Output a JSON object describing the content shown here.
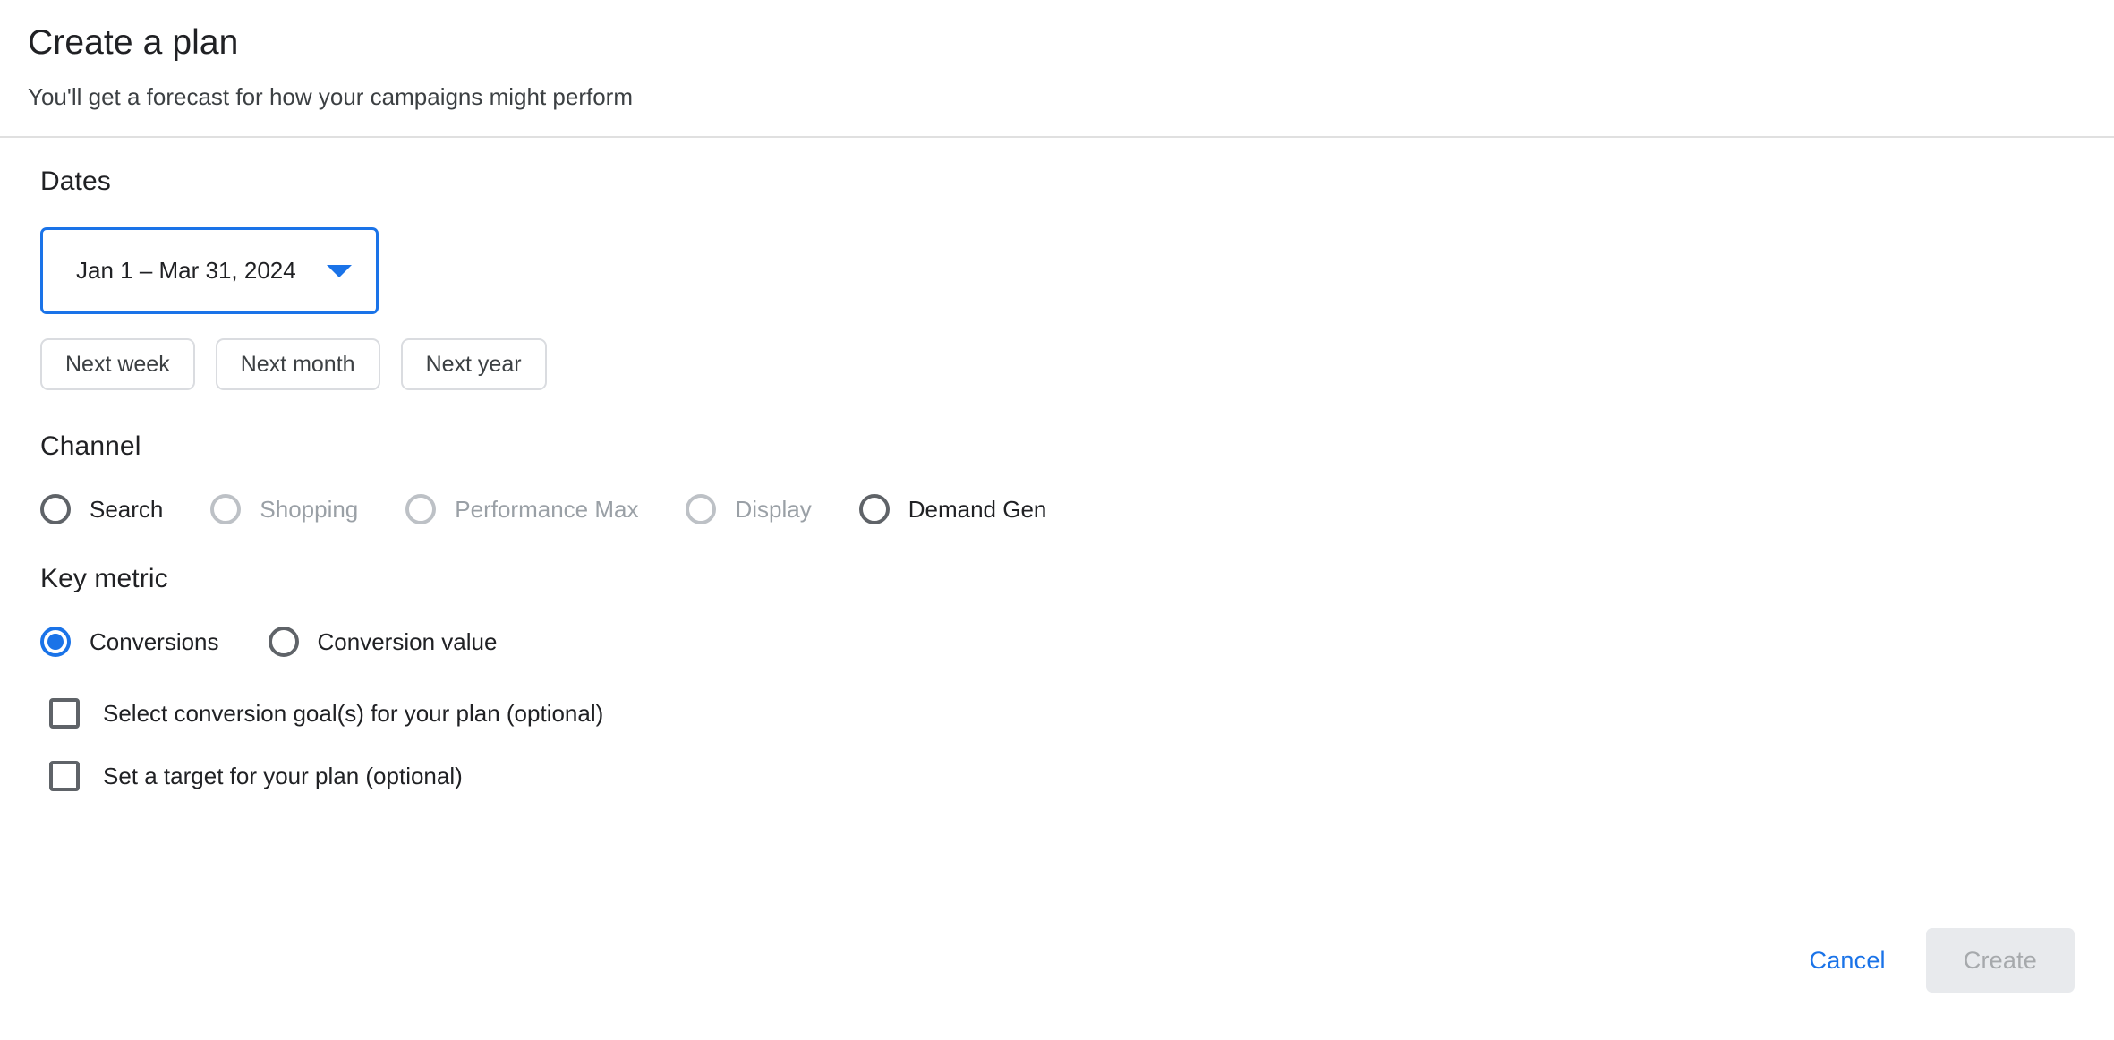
{
  "dialog": {
    "title": "Create a plan",
    "subtitle": "You'll get a forecast for how your campaigns might perform"
  },
  "dates": {
    "heading": "Dates",
    "selected_range": "Jan 1 – Mar 31, 2024",
    "caret_icon": "chevron-down-icon",
    "quick_ranges": [
      {
        "label": "Next week"
      },
      {
        "label": "Next month"
      },
      {
        "label": "Next year"
      }
    ]
  },
  "channel": {
    "heading": "Channel",
    "options": [
      {
        "label": "Search",
        "checked": false,
        "disabled": false
      },
      {
        "label": "Shopping",
        "checked": false,
        "disabled": true
      },
      {
        "label": "Performance Max",
        "checked": false,
        "disabled": true
      },
      {
        "label": "Display",
        "checked": false,
        "disabled": true
      },
      {
        "label": "Demand Gen",
        "checked": false,
        "disabled": false
      }
    ]
  },
  "key_metric": {
    "heading": "Key metric",
    "options": [
      {
        "label": "Conversions",
        "checked": true,
        "disabled": false
      },
      {
        "label": "Conversion value",
        "checked": false,
        "disabled": false
      }
    ],
    "checkboxes": [
      {
        "label": "Select conversion goal(s) for your plan (optional)",
        "checked": false
      },
      {
        "label": "Set a target for your plan (optional)",
        "checked": false
      }
    ]
  },
  "footer": {
    "cancel_label": "Cancel",
    "create_label": "Create",
    "create_disabled": true
  },
  "colors": {
    "accent": "#1a73e8",
    "text_primary": "#202124",
    "text_secondary": "#5f6368",
    "text_disabled": "#9aa0a6",
    "border": "#dadce0",
    "disabled_fill": "#e8eaed"
  }
}
